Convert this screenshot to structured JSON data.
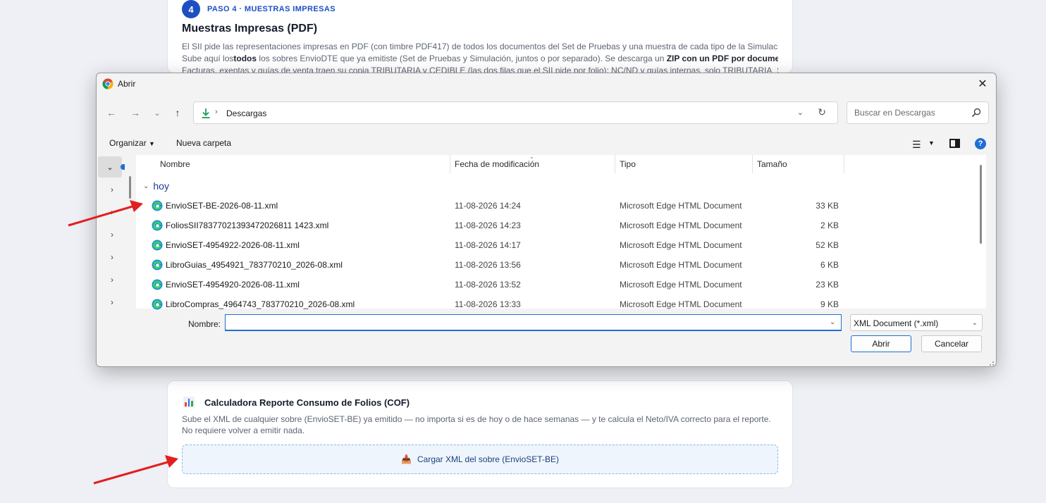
{
  "page": {
    "step_number": "4",
    "step_label": "PASO 4 · MUESTRAS IMPRESAS",
    "section_title": "Muestras Impresas (PDF)",
    "para_line1": "El SII pide las representaciones impresas en PDF (con timbre PDF417) de todos los documentos del Set de Pruebas y una muestra de cada tipo de la Simulación.",
    "para_line2_a": "Sube aquí los",
    "para_line2_b": "todos",
    "para_line2_c": " los sobres EnvioDTE que ya emitiste (Set de Pruebas y Simulación, juntos o por separado). Se descarga un ",
    "para_line2_d": "ZIP con un PDF por documento",
    "para_line2_e": ".",
    "para_line3": "Facturas, exentas y guías de venta traen su copia TRIBUTARIA y CEDIBLE (las dos filas que el SII pide por folio); NC/ND y guías internas, solo TRIBUTARIA. Sin",
    "cof_title": "Calculadora Reporte Consumo de Folios (COF)",
    "cof_desc": "Sube el XML de cualquier sobre (EnvioSET-BE) ya emitido — no importa si es de hoy o de hace semanas — y te calcula el Neto/IVA correcto para el reporte. No requiere volver a emitir nada.",
    "upload_label": "Cargar XML del sobre (EnvioSET-BE)",
    "accent_color": "#1e4fc2",
    "annotation_color": "#e02020"
  },
  "dialog": {
    "title": "Abrir",
    "path": "Descargas",
    "search_placeholder": "Buscar en Descargas",
    "organize_label": "Organizar",
    "new_folder_label": "Nueva carpeta",
    "columns": {
      "name": "Nombre",
      "date": "Fecha de modificación",
      "type": "Tipo",
      "size": "Tamaño"
    },
    "group": "hoy",
    "files": [
      {
        "name": "EnvioSET-BE-2026-08-11.xml",
        "date": "11-08-2026 14:24",
        "type": "Microsoft Edge HTML Document",
        "size": "33 KB"
      },
      {
        "name": "FoliosSII78377021393472026811 1423.xml",
        "date": "11-08-2026 14:23",
        "type": "Microsoft Edge HTML Document",
        "size": "2 KB"
      },
      {
        "name": "EnvioSET-4954922-2026-08-11.xml",
        "date": "11-08-2026 14:17",
        "type": "Microsoft Edge HTML Document",
        "size": "52 KB"
      },
      {
        "name": "LibroGuias_4954921_783770210_2026-08.xml",
        "date": "11-08-2026 13:56",
        "type": "Microsoft Edge HTML Document",
        "size": "6 KB"
      },
      {
        "name": "EnvioSET-4954920-2026-08-11.xml",
        "date": "11-08-2026 13:52",
        "type": "Microsoft Edge HTML Document",
        "size": "23 KB"
      },
      {
        "name": "LibroCompras_4964743_783770210_2026-08.xml",
        "date": "11-08-2026 13:33",
        "type": "Microsoft Edge HTML Document",
        "size": "9 KB"
      }
    ],
    "filename_label": "Nombre:",
    "filename_value": "",
    "filter_value": "XML Document (*.xml)",
    "open_label": "Abrir",
    "cancel_label": "Cancelar"
  }
}
